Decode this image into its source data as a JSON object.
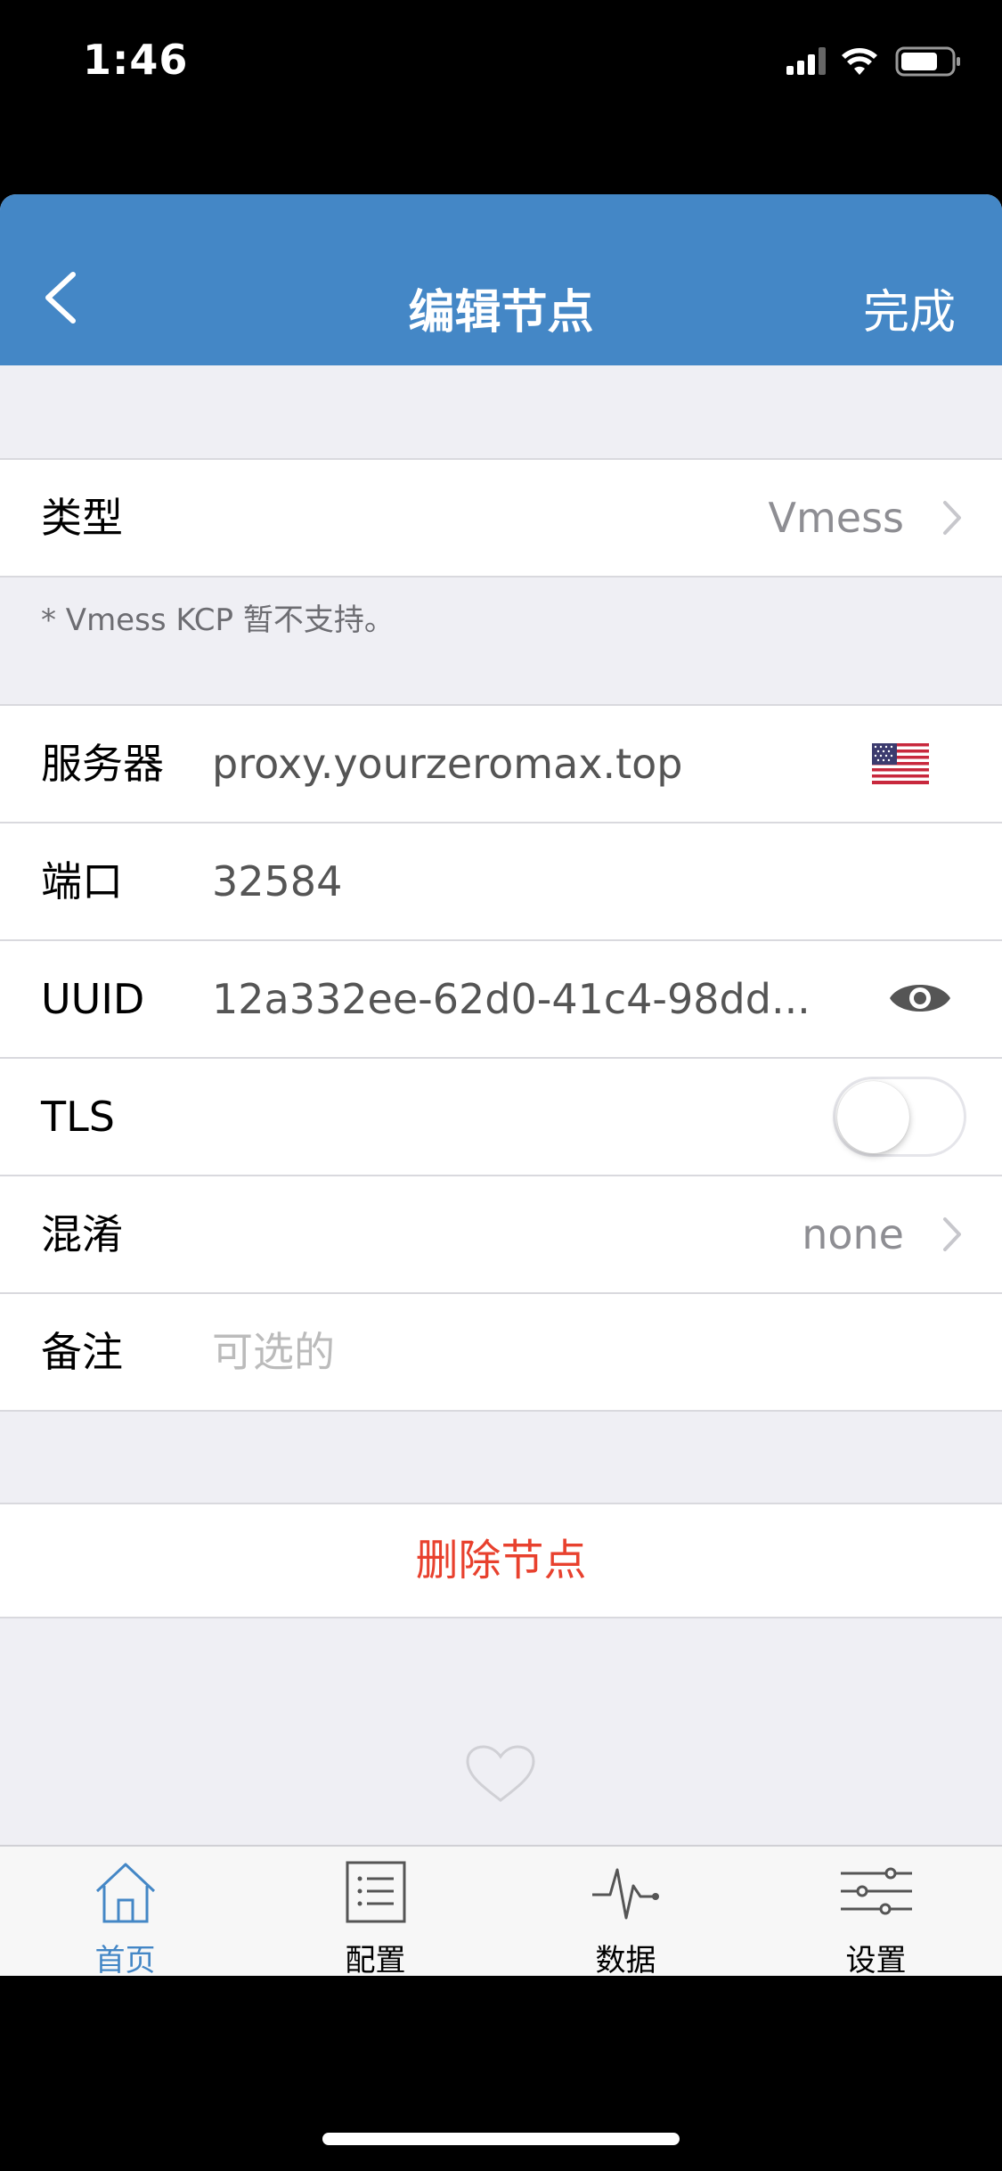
{
  "status_bar": {
    "time": "1:46"
  },
  "nav": {
    "title": "编辑节点",
    "done_label": "完成"
  },
  "type_row": {
    "label": "类型",
    "value": "Vmess"
  },
  "note": "* Vmess KCP 暂不支持。",
  "fields": {
    "server": {
      "label": "服务器",
      "value": "proxy.yourzeromax.top"
    },
    "port": {
      "label": "端口",
      "value": "32584"
    },
    "uuid": {
      "label": "UUID",
      "value": "12a332ee-62d0-41c4-98dd..."
    },
    "tls": {
      "label": "TLS",
      "enabled": false
    },
    "obfs": {
      "label": "混淆",
      "value": "none"
    },
    "remark": {
      "label": "备注",
      "placeholder": "可选的"
    }
  },
  "delete_label": "删除节点",
  "tabs": [
    {
      "label": "首页",
      "icon": "home-icon",
      "active": true
    },
    {
      "label": "配置",
      "icon": "list-icon",
      "active": false
    },
    {
      "label": "数据",
      "icon": "activity-icon",
      "active": false
    },
    {
      "label": "设置",
      "icon": "sliders-icon",
      "active": false
    }
  ],
  "colors": {
    "nav_blue": "#4487c6",
    "delete_red": "#e8412e",
    "background": "#efeff4"
  }
}
